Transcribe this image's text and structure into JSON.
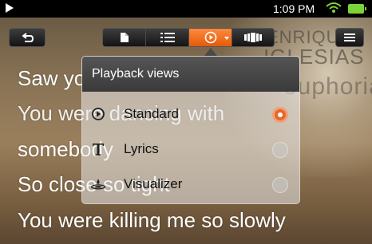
{
  "status": {
    "time": "1:09 PM"
  },
  "album_art": {
    "line1": "ENRIQUE",
    "line2": "IGLESIAS",
    "line3": "euphoria"
  },
  "toolbar": {
    "active_view": "playback"
  },
  "lyrics": [
    "Saw you in the club",
    "You were dancing with",
    "somebody",
    "So close so tight",
    "You were killing me so slowly"
  ],
  "popup": {
    "title": "Playback views",
    "options": [
      {
        "label": "Standard",
        "icon": "standard-icon",
        "selected": true
      },
      {
        "label": "Lyrics",
        "icon": "lyrics-icon",
        "selected": false
      },
      {
        "label": "Visualizer",
        "icon": "visualizer-icon",
        "selected": false
      }
    ]
  },
  "colors": {
    "accent": "#e8672b",
    "status_green": "#7cd23a"
  }
}
